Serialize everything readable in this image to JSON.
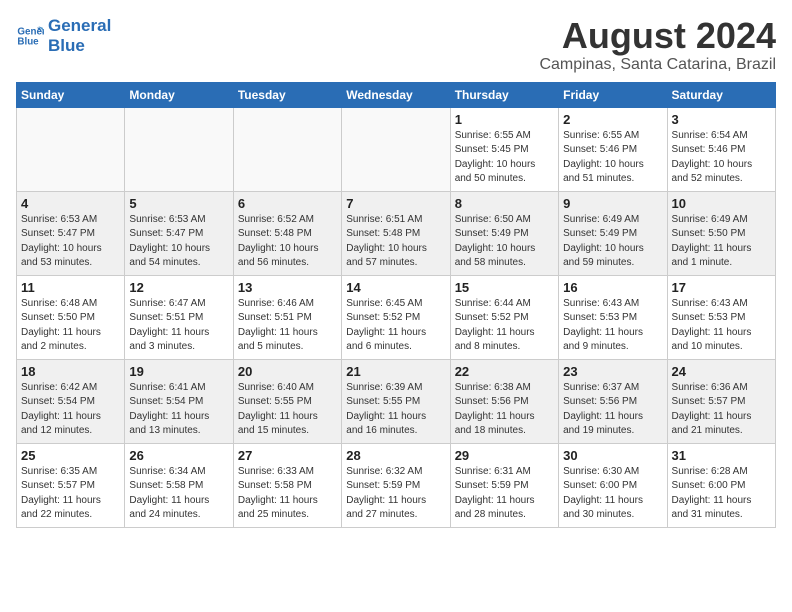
{
  "logo": {
    "line1": "General",
    "line2": "Blue"
  },
  "calendar": {
    "title": "August 2024",
    "subtitle": "Campinas, Santa Catarina, Brazil"
  },
  "weekdays": [
    "Sunday",
    "Monday",
    "Tuesday",
    "Wednesday",
    "Thursday",
    "Friday",
    "Saturday"
  ],
  "weeks": [
    [
      {
        "day": "",
        "info": "",
        "empty": true
      },
      {
        "day": "",
        "info": "",
        "empty": true
      },
      {
        "day": "",
        "info": "",
        "empty": true
      },
      {
        "day": "",
        "info": "",
        "empty": true
      },
      {
        "day": "1",
        "info": "Sunrise: 6:55 AM\nSunset: 5:45 PM\nDaylight: 10 hours\nand 50 minutes."
      },
      {
        "day": "2",
        "info": "Sunrise: 6:55 AM\nSunset: 5:46 PM\nDaylight: 10 hours\nand 51 minutes."
      },
      {
        "day": "3",
        "info": "Sunrise: 6:54 AM\nSunset: 5:46 PM\nDaylight: 10 hours\nand 52 minutes."
      }
    ],
    [
      {
        "day": "4",
        "info": "Sunrise: 6:53 AM\nSunset: 5:47 PM\nDaylight: 10 hours\nand 53 minutes."
      },
      {
        "day": "5",
        "info": "Sunrise: 6:53 AM\nSunset: 5:47 PM\nDaylight: 10 hours\nand 54 minutes."
      },
      {
        "day": "6",
        "info": "Sunrise: 6:52 AM\nSunset: 5:48 PM\nDaylight: 10 hours\nand 56 minutes."
      },
      {
        "day": "7",
        "info": "Sunrise: 6:51 AM\nSunset: 5:48 PM\nDaylight: 10 hours\nand 57 minutes."
      },
      {
        "day": "8",
        "info": "Sunrise: 6:50 AM\nSunset: 5:49 PM\nDaylight: 10 hours\nand 58 minutes."
      },
      {
        "day": "9",
        "info": "Sunrise: 6:49 AM\nSunset: 5:49 PM\nDaylight: 10 hours\nand 59 minutes."
      },
      {
        "day": "10",
        "info": "Sunrise: 6:49 AM\nSunset: 5:50 PM\nDaylight: 11 hours\nand 1 minute."
      }
    ],
    [
      {
        "day": "11",
        "info": "Sunrise: 6:48 AM\nSunset: 5:50 PM\nDaylight: 11 hours\nand 2 minutes."
      },
      {
        "day": "12",
        "info": "Sunrise: 6:47 AM\nSunset: 5:51 PM\nDaylight: 11 hours\nand 3 minutes."
      },
      {
        "day": "13",
        "info": "Sunrise: 6:46 AM\nSunset: 5:51 PM\nDaylight: 11 hours\nand 5 minutes."
      },
      {
        "day": "14",
        "info": "Sunrise: 6:45 AM\nSunset: 5:52 PM\nDaylight: 11 hours\nand 6 minutes."
      },
      {
        "day": "15",
        "info": "Sunrise: 6:44 AM\nSunset: 5:52 PM\nDaylight: 11 hours\nand 8 minutes."
      },
      {
        "day": "16",
        "info": "Sunrise: 6:43 AM\nSunset: 5:53 PM\nDaylight: 11 hours\nand 9 minutes."
      },
      {
        "day": "17",
        "info": "Sunrise: 6:43 AM\nSunset: 5:53 PM\nDaylight: 11 hours\nand 10 minutes."
      }
    ],
    [
      {
        "day": "18",
        "info": "Sunrise: 6:42 AM\nSunset: 5:54 PM\nDaylight: 11 hours\nand 12 minutes."
      },
      {
        "day": "19",
        "info": "Sunrise: 6:41 AM\nSunset: 5:54 PM\nDaylight: 11 hours\nand 13 minutes."
      },
      {
        "day": "20",
        "info": "Sunrise: 6:40 AM\nSunset: 5:55 PM\nDaylight: 11 hours\nand 15 minutes."
      },
      {
        "day": "21",
        "info": "Sunrise: 6:39 AM\nSunset: 5:55 PM\nDaylight: 11 hours\nand 16 minutes."
      },
      {
        "day": "22",
        "info": "Sunrise: 6:38 AM\nSunset: 5:56 PM\nDaylight: 11 hours\nand 18 minutes."
      },
      {
        "day": "23",
        "info": "Sunrise: 6:37 AM\nSunset: 5:56 PM\nDaylight: 11 hours\nand 19 minutes."
      },
      {
        "day": "24",
        "info": "Sunrise: 6:36 AM\nSunset: 5:57 PM\nDaylight: 11 hours\nand 21 minutes."
      }
    ],
    [
      {
        "day": "25",
        "info": "Sunrise: 6:35 AM\nSunset: 5:57 PM\nDaylight: 11 hours\nand 22 minutes."
      },
      {
        "day": "26",
        "info": "Sunrise: 6:34 AM\nSunset: 5:58 PM\nDaylight: 11 hours\nand 24 minutes."
      },
      {
        "day": "27",
        "info": "Sunrise: 6:33 AM\nSunset: 5:58 PM\nDaylight: 11 hours\nand 25 minutes."
      },
      {
        "day": "28",
        "info": "Sunrise: 6:32 AM\nSunset: 5:59 PM\nDaylight: 11 hours\nand 27 minutes."
      },
      {
        "day": "29",
        "info": "Sunrise: 6:31 AM\nSunset: 5:59 PM\nDaylight: 11 hours\nand 28 minutes."
      },
      {
        "day": "30",
        "info": "Sunrise: 6:30 AM\nSunset: 6:00 PM\nDaylight: 11 hours\nand 30 minutes."
      },
      {
        "day": "31",
        "info": "Sunrise: 6:28 AM\nSunset: 6:00 PM\nDaylight: 11 hours\nand 31 minutes."
      }
    ]
  ]
}
